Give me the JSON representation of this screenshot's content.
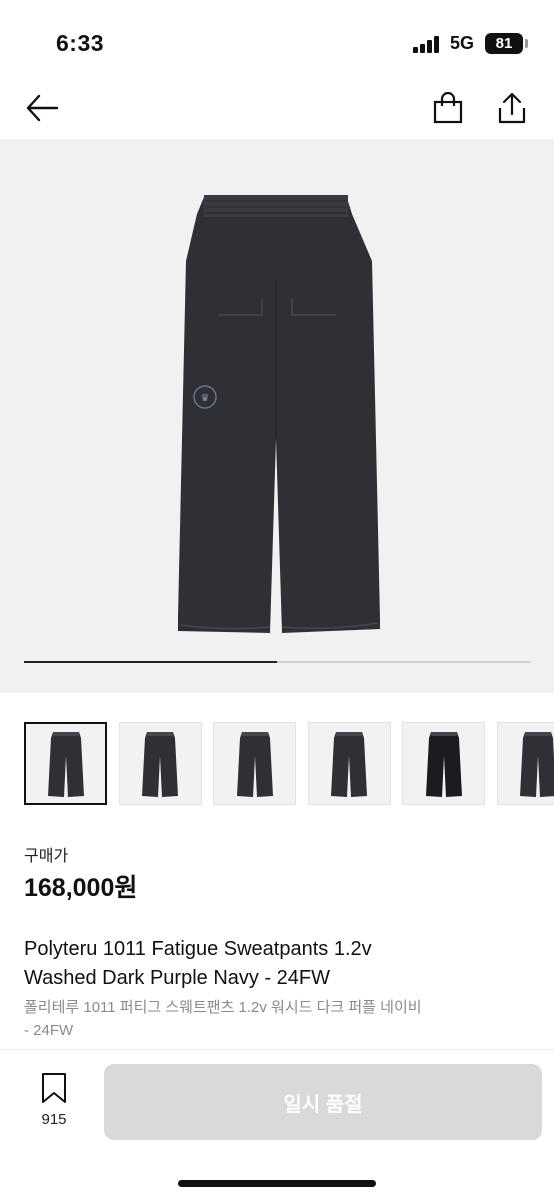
{
  "status": {
    "time": "6:33",
    "network": "5G",
    "battery": "81"
  },
  "nav": {
    "back_icon": "arrow-left-icon",
    "bag_icon": "shopping-bag-icon",
    "share_icon": "share-icon"
  },
  "gallery": {
    "image_count": 6,
    "active_index": 0,
    "progress": 0.5,
    "product_color": "#2f2f36"
  },
  "product": {
    "price_label": "구매가",
    "price": "168,000원",
    "title_en_line1": "Polyteru 1011 Fatigue Sweatpants 1.2v",
    "title_en_line2": "Washed Dark Purple Navy - 24FW",
    "title_ko_line1": "폴리테루 1011 퍼티그 스웨트팬츠 1.2v 워시드 다크 퍼플 네이비",
    "title_ko_line2": "- 24FW"
  },
  "bottom_bar": {
    "bookmark_icon": "bookmark-icon",
    "bookmark_count": "915",
    "soldout_label": "일시 품절"
  }
}
